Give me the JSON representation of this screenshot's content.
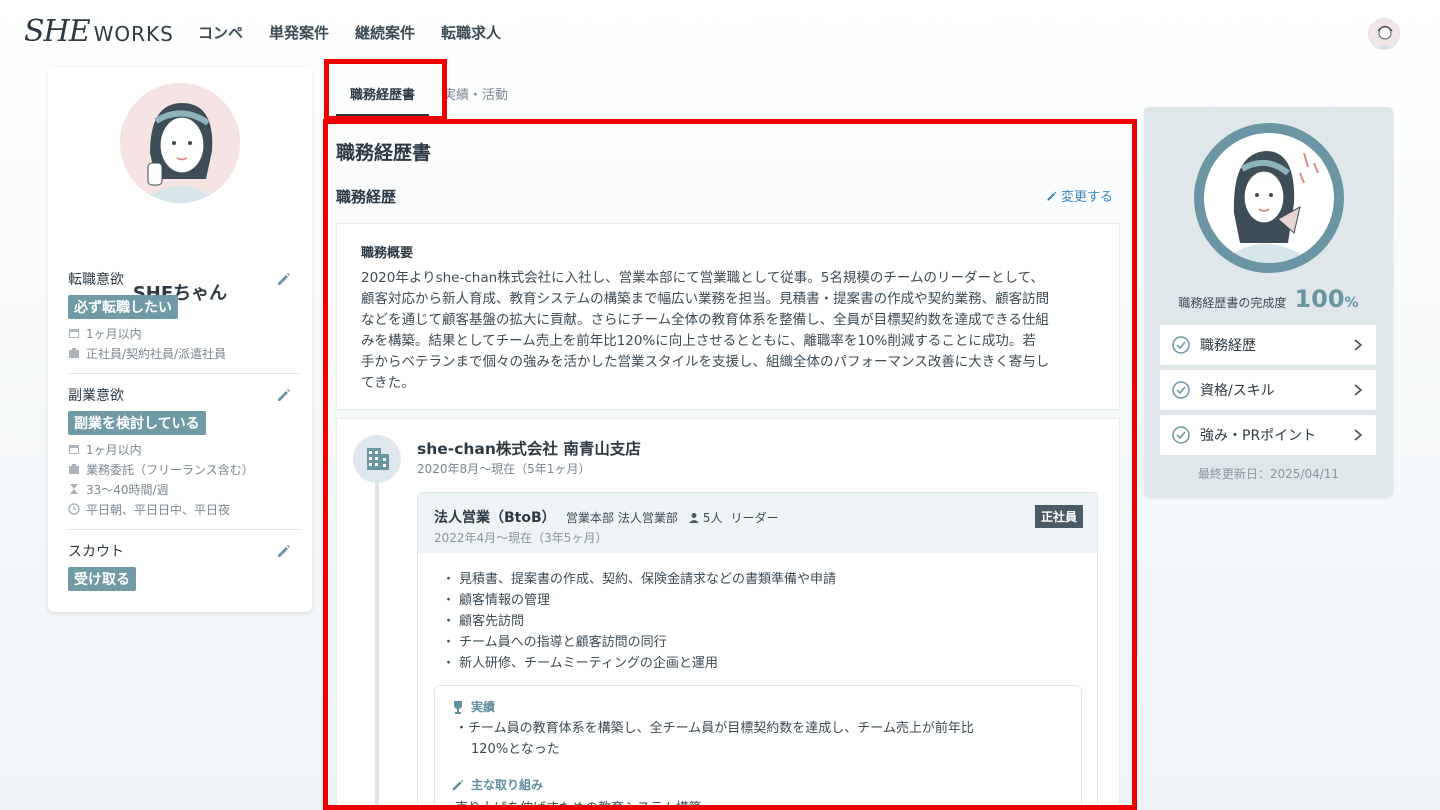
{
  "header": {
    "logo_she": "SHE",
    "logo_works": "WORKS",
    "nav": [
      "コンペ",
      "単発案件",
      "継続案件",
      "転職求人"
    ]
  },
  "profile": {
    "name": "SHEちゃん",
    "job_change": {
      "title": "転職意欲",
      "badge": "必ず転職したい",
      "timing": "1ヶ月以内",
      "employment": "正社員/契約社員/派遣社員"
    },
    "side_job": {
      "title": "副業意欲",
      "badge": "副業を検討している",
      "timing": "1ヶ月以内",
      "contract": "業務委託（フリーランス含む）",
      "hours": "33〜40時間/週",
      "time": "平日朝、平日日中、平日夜"
    },
    "scout": {
      "title": "スカウト",
      "badge": "受け取る"
    }
  },
  "tabs": [
    "職務経歴書",
    "実績・活動"
  ],
  "main": {
    "title": "職務経歴書",
    "section_title": "職務経歴",
    "edit_label": "変更する",
    "summary_head": "職務概要",
    "summary_lines": [
      "2020年よりshe-chan株式会社に入社し、営業本部にて営業職として従事。5名規模のチームのリーダーとして、",
      "顧客対応から新人育成、教育システムの構築まで幅広い業務を担当。見積書・提案書の作成や契約業務、顧客訪問",
      "などを通じて顧客基盤の拡大に貢献。さらにチーム全体の教育体系を整備し、全員が目標契約数を達成できる仕組",
      "みを構築。結果としてチーム売上を前年比120%に向上させるとともに、離職率を10%削減することに成功。若",
      "手からベテランまで個々の強みを活かした営業スタイルを支援し、組織全体のパフォーマンス改善に大きく寄与し",
      "てきた。"
    ],
    "company": {
      "name": "she-chan株式会社 南青山支店",
      "period": "2020年8月〜現在（5年1ヶ月）",
      "role": {
        "title": "法人営業（BtoB）",
        "dept": "営業本部 法人営業部",
        "members": "5人",
        "position": "リーダー",
        "period": "2022年4月〜現在（3年5ヶ月）",
        "badge": "正社員",
        "duties": [
          "見積書、提案書の作成、契約、保険金請求などの書類準備や申請",
          "顧客情報の管理",
          "顧客先訪問",
          "チーム員への指導と顧客訪問の同行",
          "新人研修、チームミーティングの企画と運用"
        ],
        "achievement_label": "実績",
        "achievement_line1": "チーム員の教育体系を構築し、全チーム員が目標契約数を達成し、チーム売上が前年比",
        "achievement_line2": "120%となった",
        "initiative_label": "主な取り組み",
        "initiative_text": "売り上げを伸ばすための教育システム構築"
      }
    }
  },
  "completion": {
    "label": "職務経歴書の完成度",
    "value": "100",
    "unit": "%",
    "items": [
      "職務経歴",
      "資格/スキル",
      "強み・PRポイント"
    ],
    "updated": "最終更新日：2025/04/11"
  },
  "colors": {
    "accent": "#6b95a2",
    "highlight": "#ee0000",
    "link": "#3a86c0"
  }
}
